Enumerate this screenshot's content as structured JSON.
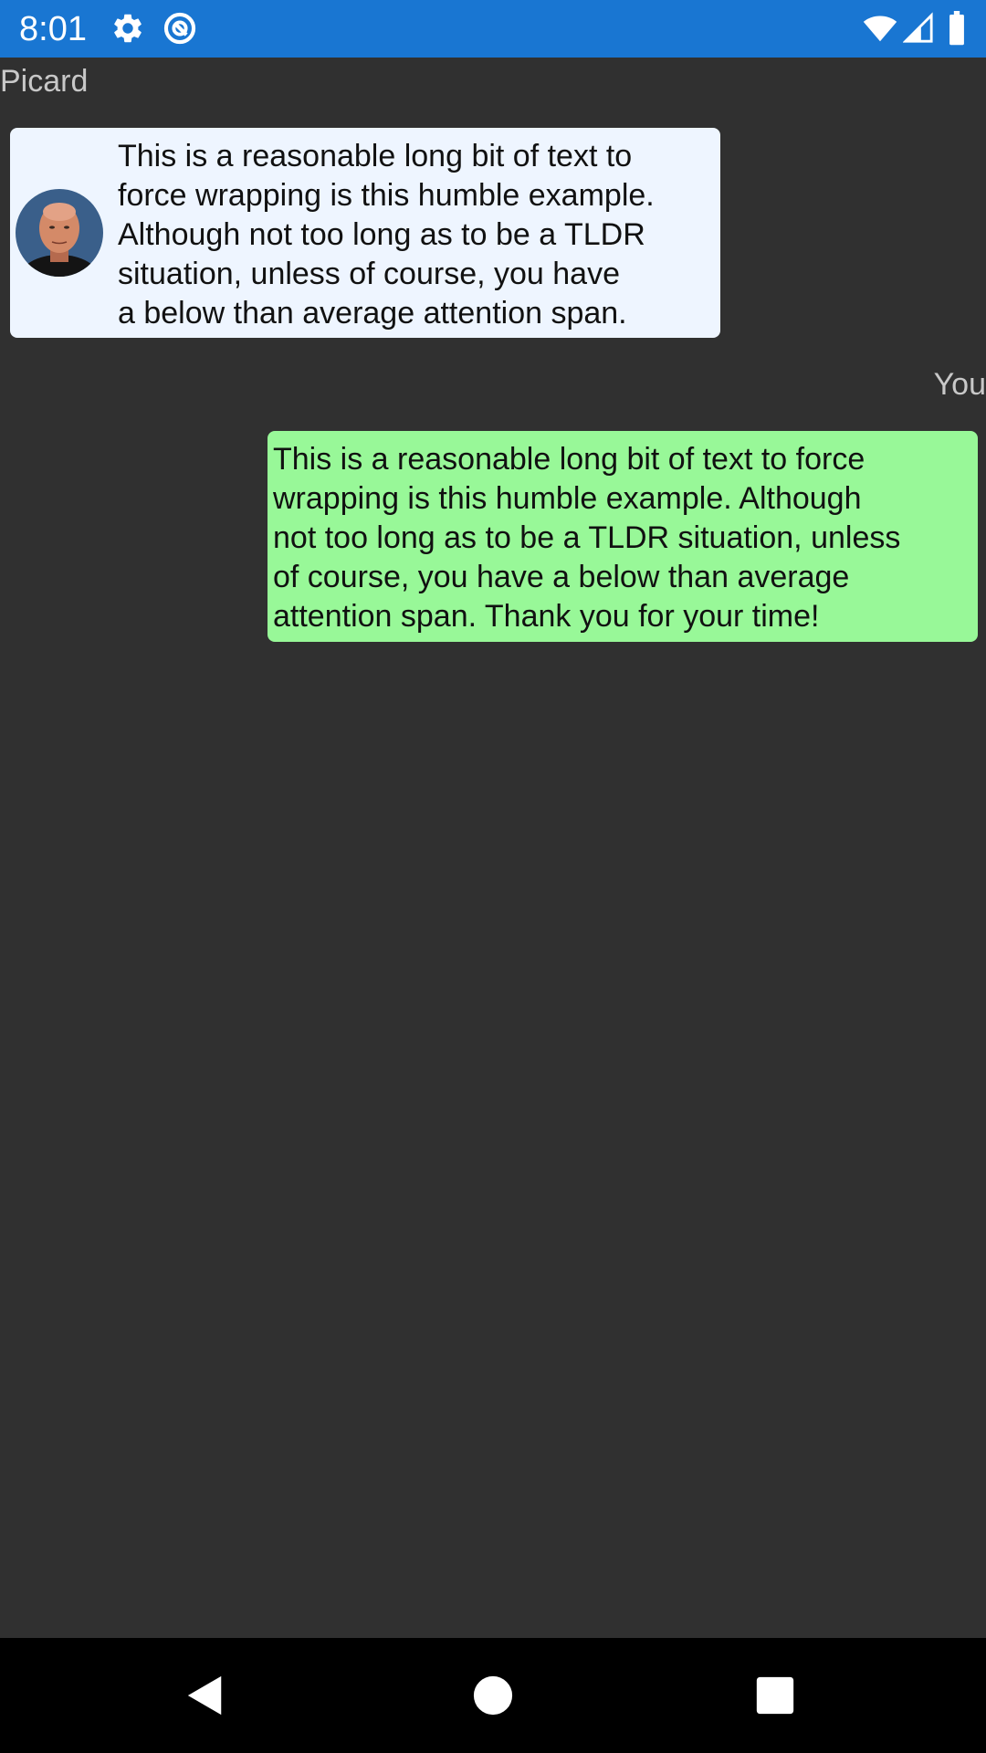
{
  "status_bar": {
    "time": "8:01",
    "icons": [
      "gear-icon",
      "sync-icon",
      "wifi-icon",
      "cell-signal-icon",
      "battery-icon"
    ],
    "background_color": "#1976D2"
  },
  "chat": {
    "background_color": "#303030",
    "messages": [
      {
        "sender": "Picard",
        "text": "This is a reasonable long bit of text to\nforce wrapping is this humble example.\nAlthough not too long as to be a TLDR\nsituation, unless of course, you have\na below than average attention span.",
        "bubble_color": "#EEF5FF",
        "avatar": "picard-avatar"
      },
      {
        "sender": "You",
        "text": "This is a reasonable long bit of text to force\nwrapping is this humble example. Although\nnot too long as to be a TLDR situation, unless\nof course, you have a below than average\nattention span. Thank you for your time!",
        "bubble_color": "#98F898"
      }
    ]
  },
  "nav_bar": {
    "buttons": [
      "back-icon",
      "home-icon",
      "recents-icon"
    ]
  }
}
